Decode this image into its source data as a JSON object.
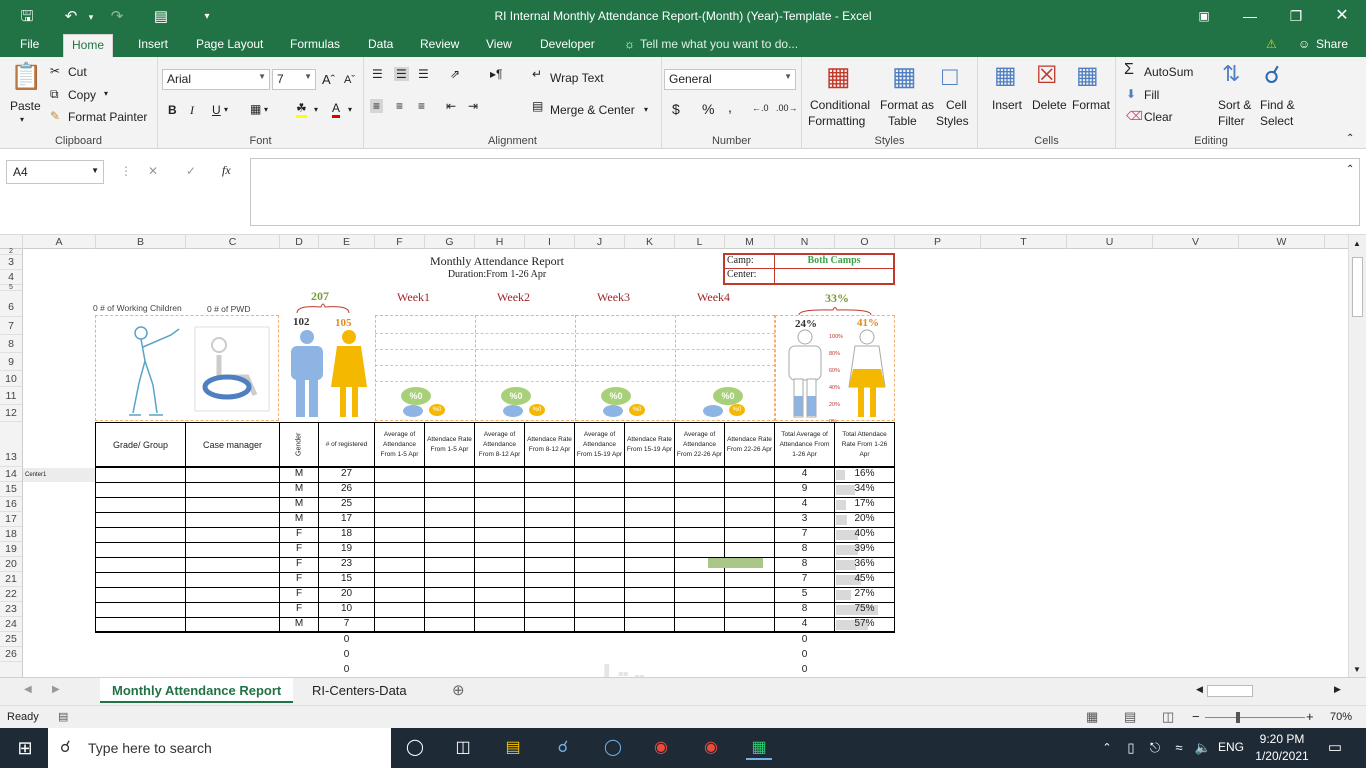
{
  "window": {
    "title": "RI Internal Monthly Attendance Report-(Month) (Year)-Template - Excel",
    "share": "Share"
  },
  "tabs": [
    "File",
    "Home",
    "Insert",
    "Page Layout",
    "Formulas",
    "Data",
    "Review",
    "View",
    "Developer"
  ],
  "tell_me": "Tell me what you want to do...",
  "ribbon": {
    "clipboard": {
      "paste": "Paste",
      "cut": "Cut",
      "copy": "Copy",
      "format_painter": "Format Painter",
      "label": "Clipboard"
    },
    "font": {
      "name": "Arial",
      "size": "7",
      "label": "Font",
      "bold": "B",
      "italic": "I",
      "underline": "U"
    },
    "alignment": {
      "wrap": "Wrap Text",
      "merge": "Merge & Center",
      "label": "Alignment"
    },
    "number": {
      "format": "General",
      "label": "Number",
      "currency": "$",
      "percent": "%",
      "comma": ","
    },
    "styles": {
      "cond1": "Conditional",
      "cond2": "Formatting",
      "fmt1": "Format as",
      "fmt2": "Table",
      "cell1": "Cell",
      "cell2": "Styles",
      "label": "Styles"
    },
    "cells": {
      "insert": "Insert",
      "delete": "Delete",
      "format": "Format",
      "label": "Cells"
    },
    "editing": {
      "autosum": "AutoSum",
      "fill": "Fill",
      "clear": "Clear",
      "sort1": "Sort &",
      "sort2": "Filter",
      "find1": "Find &",
      "find2": "Select",
      "label": "Editing"
    }
  },
  "formula_bar": {
    "name_box": "A4",
    "fx": "fx",
    "content": ""
  },
  "columns": [
    "A",
    "B",
    "C",
    "D",
    "E",
    "F",
    "G",
    "H",
    "I",
    "J",
    "K",
    "L",
    "M",
    "N",
    "O",
    "P",
    "T",
    "U",
    "V",
    "W"
  ],
  "rows": [
    "2",
    "3",
    "4",
    "5",
    "6",
    "7",
    "8",
    "9",
    "10",
    "11",
    "12",
    "13",
    "14",
    "15",
    "16",
    "17",
    "18",
    "19",
    "20",
    "21",
    "22",
    "23",
    "24",
    "25",
    "26"
  ],
  "report": {
    "title": "Monthly Attendance Report",
    "duration": "Duration:From 1-26 Apr",
    "camp_label": "Camp:",
    "camp_value": "Both Camps",
    "center_label": "Center:",
    "working_children": "0 # of Working Children",
    "pwd": "0 # of PWD",
    "total": "207",
    "male_count": "102",
    "female_count": "105",
    "weeks": [
      "Week1",
      "Week2",
      "Week3",
      "Week4"
    ],
    "week_bubble": "%0",
    "week_small": "%0",
    "overall_pct": "33%",
    "male_pct": "24%",
    "female_pct": "41%",
    "scale": [
      "100%",
      "80%",
      "60%",
      "40%",
      "20%",
      "0%"
    ],
    "headers": [
      "Grade/ Group",
      "Case manager",
      "Gender",
      "# of registered",
      "Average of Attendance From 1-5 Apr",
      "Attendace Rate From 1-5 Apr",
      "Average of Attendance From 8-12 Apr",
      "Attendace Rate From 8-12 Apr",
      "Average of Attendance From 15-19 Apr",
      "Attendace Rate From 15-19 Apr",
      "Average of Attendance From 22-26 Apr",
      "Attendace Rate From 22-26 Apr",
      "Total Average of Attendance From 1-26 Apr",
      "Total Attendace Rate From 1-26 Apr"
    ],
    "center_name": "Center1",
    "data": [
      {
        "g": "M",
        "reg": "27",
        "avg": "4",
        "rate": "16%"
      },
      {
        "g": "M",
        "reg": "26",
        "avg": "9",
        "rate": "34%"
      },
      {
        "g": "M",
        "reg": "25",
        "avg": "4",
        "rate": "17%"
      },
      {
        "g": "M",
        "reg": "17",
        "avg": "3",
        "rate": "20%"
      },
      {
        "g": "F",
        "reg": "18",
        "avg": "7",
        "rate": "40%"
      },
      {
        "g": "F",
        "reg": "19",
        "avg": "8",
        "rate": "39%"
      },
      {
        "g": "F",
        "reg": "23",
        "avg": "8",
        "rate": "36%"
      },
      {
        "g": "F",
        "reg": "15",
        "avg": "7",
        "rate": "45%"
      },
      {
        "g": "F",
        "reg": "20",
        "avg": "5",
        "rate": "27%"
      },
      {
        "g": "F",
        "reg": "10",
        "avg": "8",
        "rate": "75%"
      },
      {
        "g": "M",
        "reg": "7",
        "avg": "4",
        "rate": "57%"
      }
    ],
    "zeros": [
      "0",
      "0",
      "0"
    ]
  },
  "sheets": [
    "Monthly Attendance Report",
    "RI-Centers-Data"
  ],
  "status": {
    "ready": "Ready",
    "zoom": "70%"
  },
  "taskbar": {
    "search": "Type here to search",
    "time": "9:20 PM",
    "date": "1/20/2021",
    "lang": "ENG"
  },
  "colors": {
    "excel_green": "#217346",
    "week_red": "#a0282b",
    "camp_green": "#3aa64b",
    "male_blue": "#8eb4e3",
    "female_yellow": "#f5b800"
  }
}
